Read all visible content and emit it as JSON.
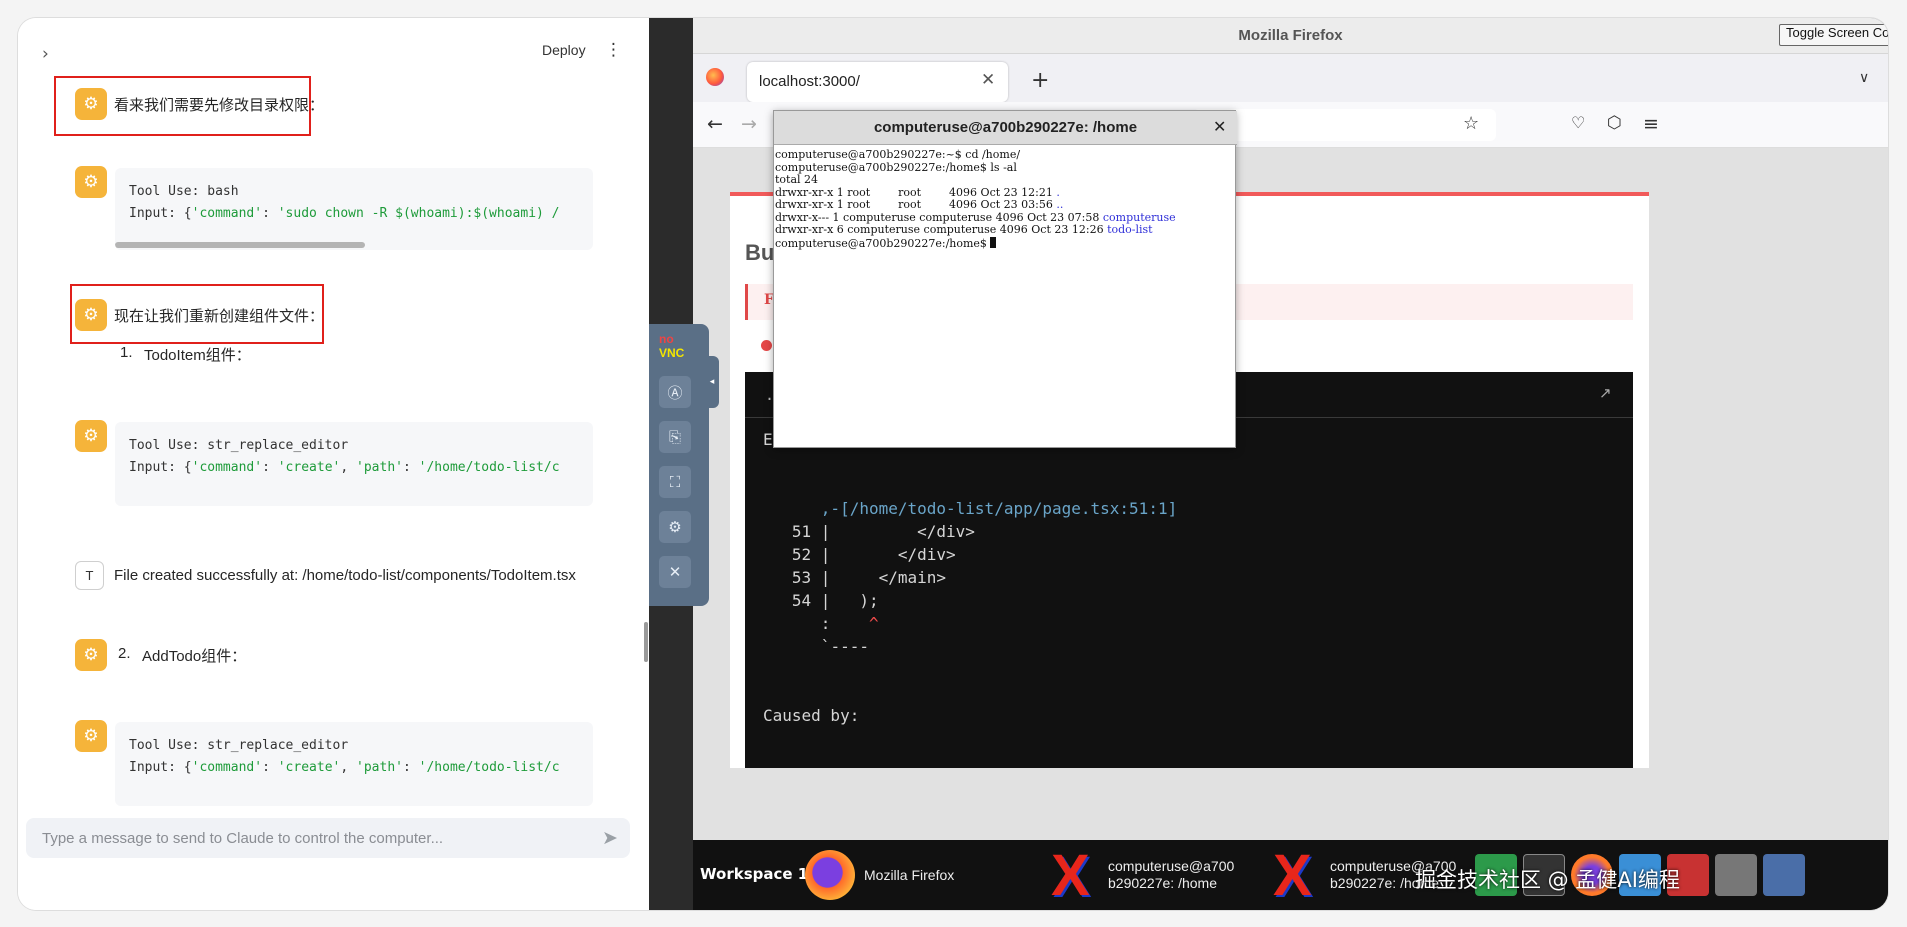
{
  "chat": {
    "deploy_label": "Deploy",
    "messages": [
      {
        "type": "text",
        "text": "看来我们需要先修改目录权限："
      },
      {
        "type": "tool",
        "line1": "Tool Use: bash",
        "line2_prefix": "Input: {",
        "line2_key": "'command'",
        "line2_sep": ": ",
        "line2_val": "'sudo chown -R $(whoami):$(whoami) /"
      },
      {
        "type": "text",
        "text": "现在让我们重新创建组件文件："
      },
      {
        "type": "list",
        "num": "1.",
        "text": "TodoItem组件："
      },
      {
        "type": "tool",
        "line1": "Tool Use: str_replace_editor",
        "line2_prefix": "Input: {",
        "line2_key": "'command'",
        "line2_sep": ": ",
        "line2_val": "'create'",
        "line2_key2": "'path'",
        "line2_val2": "'/home/todo-list/c"
      },
      {
        "type": "result",
        "avatar": "T",
        "text": "File created successfully at: /home/todo-list/components/TodoItem.tsx"
      },
      {
        "type": "list",
        "num": "2.",
        "text": "AddTodo组件："
      },
      {
        "type": "tool",
        "line1": "Tool Use: str_replace_editor",
        "line2_prefix": "Input: {",
        "line2_key": "'command'",
        "line2_sep": ": ",
        "line2_val": "'create'",
        "line2_key2": "'path'",
        "line2_val2": "'/home/todo-list/c"
      }
    ],
    "input_placeholder": "Type a message to send to Claude to control the computer..."
  },
  "novnc": {
    "logo_no": "no",
    "logo_vnc": "VNC"
  },
  "firefox": {
    "window_title": "Mozilla Firefox",
    "toggle_button": "Toggle Screen Control (",
    "tab_label": "localhost:3000/",
    "page": {
      "heading": "Bui",
      "fail_text": "Fa",
      "terminal_header": "./",
      "terminal_lines": {
        "l0": "Er",
        "path": ",-[/home/todo-list/app/page.tsx:51:1]",
        "l51": "51 |         </div>",
        "l52": "52 |       </div>",
        "l53": "53 |     </main>",
        "l54": "54 |   );",
        "caret_prefix": "   :    ",
        "caret": "^",
        "tail": "   `----",
        "caused": "Caused by:"
      }
    }
  },
  "xterm": {
    "title": "computeruse@a700b290227e: /home",
    "lines": [
      "computeruse@a700b290227e:~$ cd /home/",
      "computeruse@a700b290227e:/home$ ls -al",
      "total 24"
    ],
    "entries": [
      {
        "perm": "drwxr-xr-x 1 root        root        4096 Oct 23 12:21 ",
        "name": "."
      },
      {
        "perm": "drwxr-xr-x 1 root        root        4096 Oct 23 03:56 ",
        "name": ".."
      },
      {
        "perm": "drwxr-x--- 1 computeruse computeruse 4096 Oct 23 07:58 ",
        "name": "computeruse"
      },
      {
        "perm": "drwxr-xr-x 6 computeruse computeruse 4096 Oct 23 12:26 ",
        "name": "todo-list"
      }
    ],
    "prompt": "computeruse@a700b290227e:/home$ "
  },
  "taskbar": {
    "workspace": "Workspace 1",
    "firefox_label": "Mozilla Firefox",
    "term1_line1": "computeruse@a700",
    "term1_line2": "b290227e: /home",
    "term2_line1": "computeruse@a700",
    "term2_line2": "b290227e: /home",
    "watermark": "掘金技术社区 @ 孟健AI编程"
  }
}
